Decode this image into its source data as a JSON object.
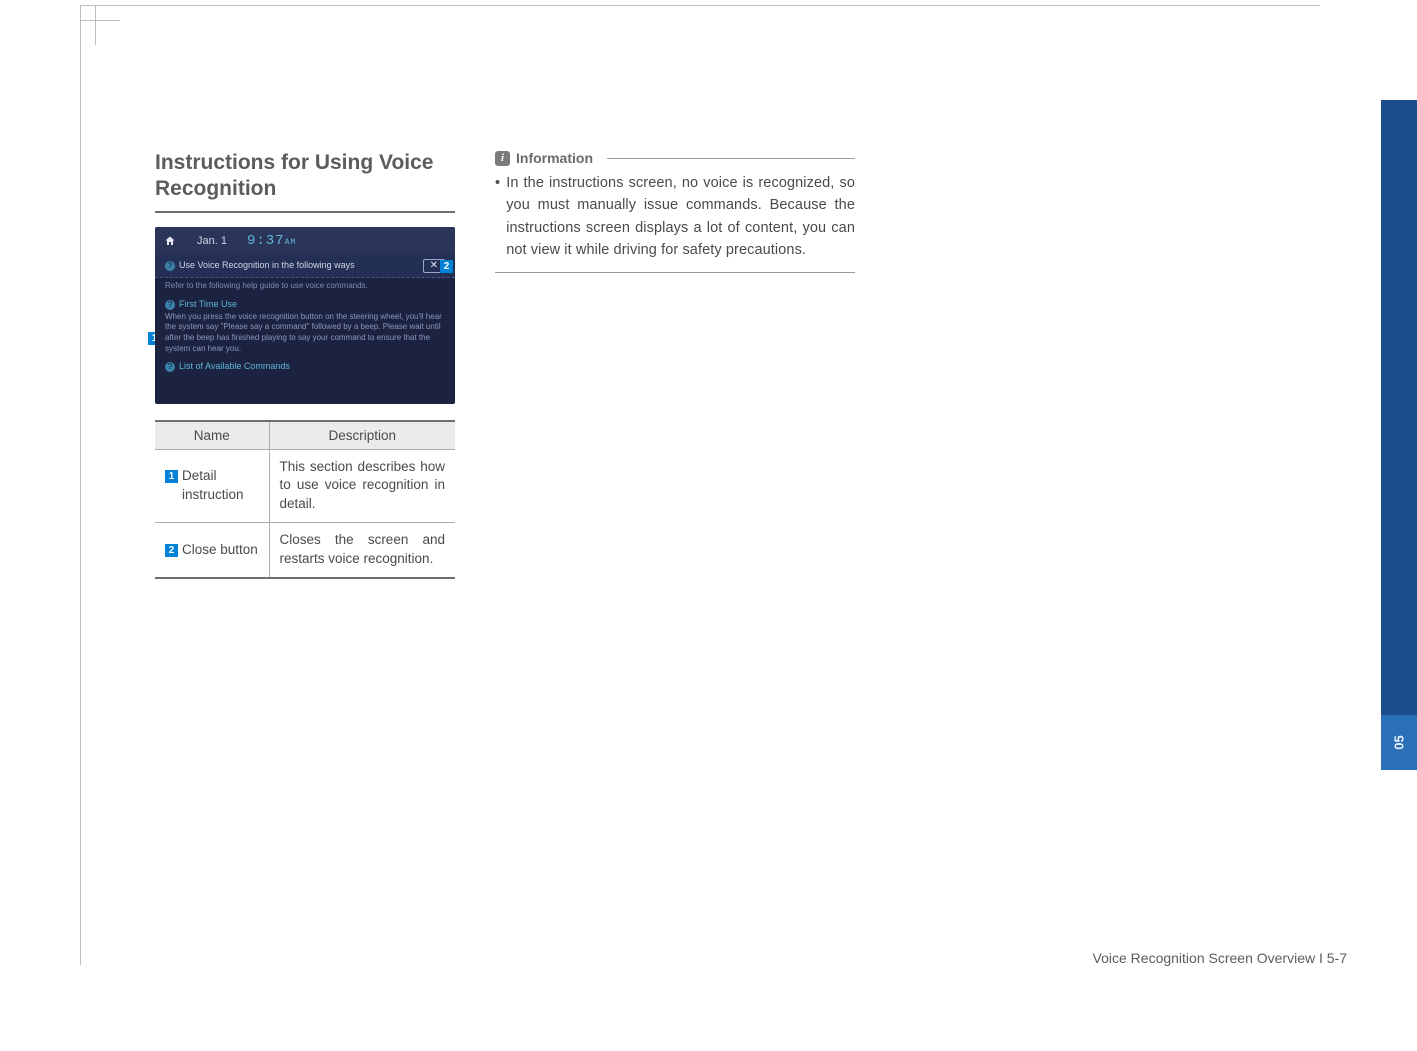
{
  "heading": "Instructions for Using Voice Recognition",
  "device": {
    "date": "Jan.  1",
    "time": "9:37",
    "ampm": "AM",
    "bar_title": "Use Voice Recognition in the following ways",
    "close_glyph": "✕",
    "subtext": "Refer to the following help guide to use voice commands.",
    "block_title": "First Time Use",
    "block_body": "When you press the voice recognition button on the steering wheel, you'll hear the system say \"Please say a command\" followed by a beep. Please wait until after the beep has finished playing to say your command to ensure that the system can hear you.",
    "list_title": "List of Available Commands"
  },
  "callouts": {
    "one": "1",
    "two": "2"
  },
  "table": {
    "head_name": "Name",
    "head_desc": "Description",
    "rows": [
      {
        "num": "1",
        "name": "Detail instruction",
        "desc": "This section describes how to use voice recognition in detail."
      },
      {
        "num": "2",
        "name": "Close button",
        "desc": "Closes the screen and restarts voice recognition."
      }
    ]
  },
  "info": {
    "title": "Information",
    "bullet": "In the instructions screen, no voice is recognized, so you must manually issue commands. Because the instructions screen displays a lot of content, you can not view it while driving for safety precautions."
  },
  "side_tab": "05",
  "footer": "Voice Recognition Screen Overview I 5-7"
}
